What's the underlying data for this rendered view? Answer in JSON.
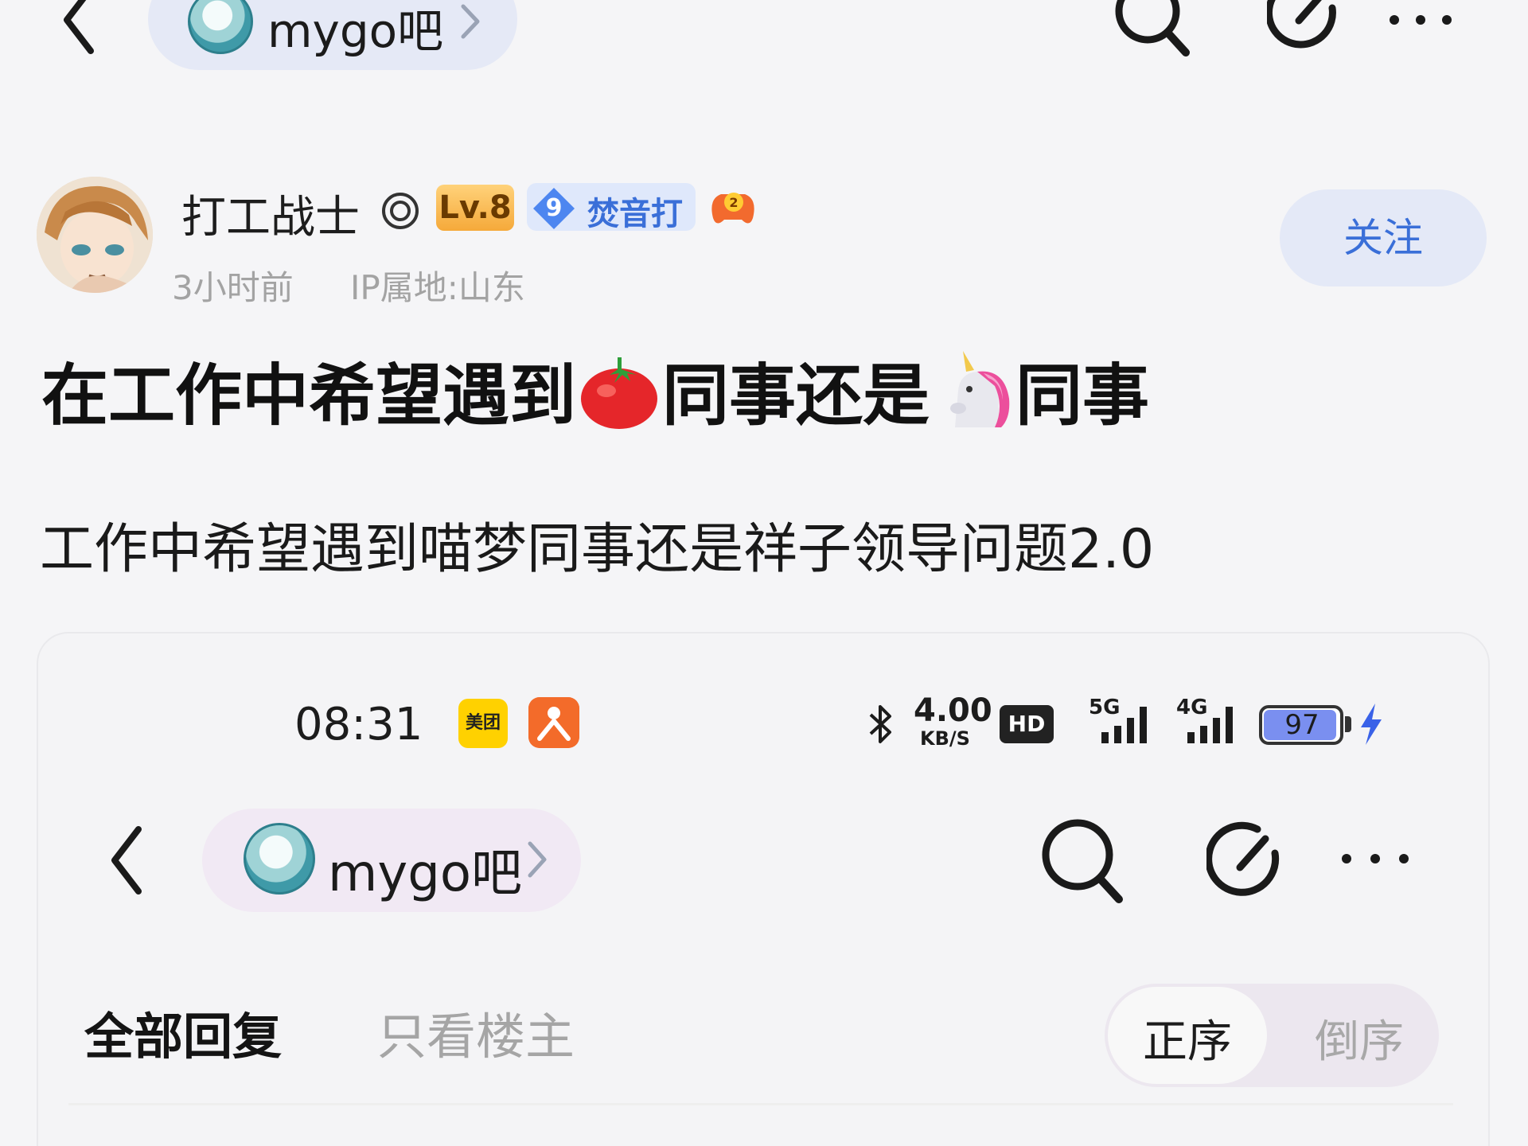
{
  "top_nav": {
    "forum_name": "mygo吧",
    "icons": [
      "back-arrow-icon",
      "forum-avatar",
      "chevron-right-icon",
      "search-icon",
      "compose-icon",
      "more-icon"
    ]
  },
  "author": {
    "name": "打工战士",
    "level_badge": "Lv.8",
    "fan_level": "9",
    "fan_label": "焚音打",
    "time": "3小时前",
    "ip": "IP属地:山东",
    "follow_label": "关注"
  },
  "post": {
    "title_parts": [
      "在工作中希望遇到",
      "同事还是",
      "同事"
    ],
    "title_emojis": [
      "tomato-icon",
      "unicorn-icon"
    ],
    "body": "工作中希望遇到喵梦同事还是祥子领导问题2.0"
  },
  "embedded_screenshot": {
    "status_bar": {
      "time": "08:31",
      "meituan_label": "美团",
      "net_speed": "4.00",
      "net_speed_unit": "KB/S",
      "hd_label": "HD",
      "sim1_label": "5G",
      "sim2_label": "4G",
      "battery": "97",
      "battery_level": 0.97
    },
    "nav": {
      "forum_name": "mygo吧"
    },
    "tabs": {
      "all_replies": "全部回复",
      "op_only": "只看楼主"
    },
    "sort": {
      "ascending": "正序",
      "descending": "倒序"
    }
  },
  "colors": {
    "background": "#f5f5f7",
    "accent_blue": "#3a6fd8",
    "follow_bg": "#e4e9f7",
    "level_badge": "#f5a93a"
  }
}
